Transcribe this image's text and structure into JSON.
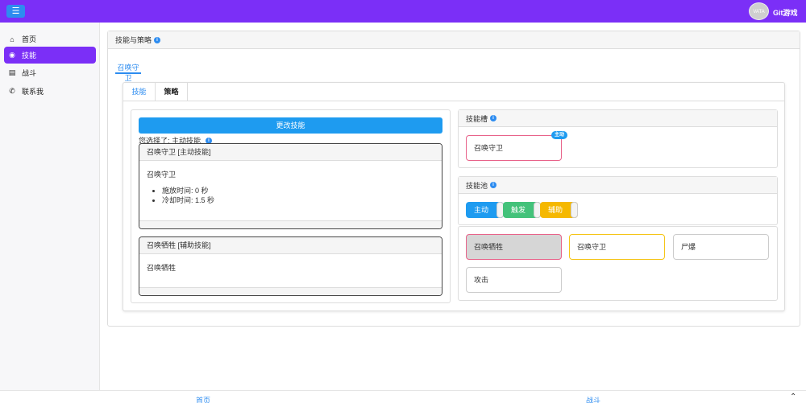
{
  "header": {
    "menu_icon": "☰",
    "avatar_text": "VATA",
    "brand": "Git游戏"
  },
  "sidebar": {
    "items": [
      {
        "icon": "home-icon",
        "glyph": "⌂",
        "label": "首页"
      },
      {
        "icon": "bolt-icon",
        "glyph": "◉",
        "label": "技能"
      },
      {
        "icon": "map-icon",
        "glyph": "▤",
        "label": "战斗"
      },
      {
        "icon": "phone-icon",
        "glyph": "✆",
        "label": "联系我"
      }
    ]
  },
  "page": {
    "title": "技能与策略",
    "outer_tab": "召唤守卫",
    "inner_tabs": [
      "技能",
      "策略"
    ]
  },
  "left": {
    "change_button": "更改技能",
    "chosen_text": "您选择了: 主动技能",
    "skills": [
      {
        "header": "召唤守卫 [主动技能]",
        "name": "召唤守卫",
        "details": [
          "施放时间: 0 秒",
          "冷却时间: 1.5 秒"
        ]
      },
      {
        "header": "召唤牺牲 [辅助技能]",
        "name": "召唤牺牲",
        "details": []
      }
    ]
  },
  "slot_panel": {
    "title": "技能槽",
    "slot_name": "召唤守卫",
    "badge": "主动"
  },
  "pool_panel": {
    "title": "技能池",
    "toggles": [
      {
        "label": "主动",
        "color": "#1e9bf0"
      },
      {
        "label": "触发",
        "color": "#43c27a"
      },
      {
        "label": "辅助",
        "color": "#f5b800"
      }
    ],
    "skills": [
      "召唤牺牲",
      "召唤守卫",
      "尸爆",
      "攻击"
    ]
  },
  "bottom_nav": {
    "home": "首页",
    "battle": "战斗",
    "up_icon": "⌃"
  },
  "colors": {
    "accent": "#7b2ff7",
    "primary": "#1e9bf0"
  }
}
